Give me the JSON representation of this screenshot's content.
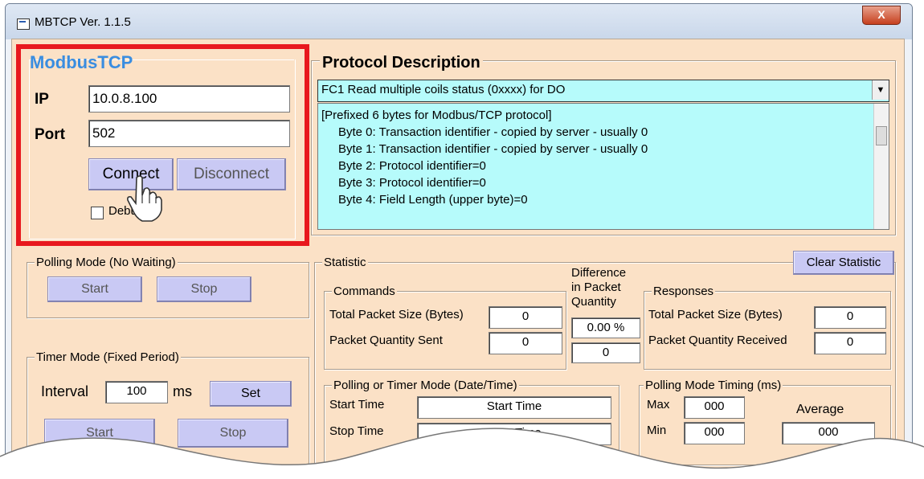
{
  "window": {
    "title": "MBTCP  Ver. 1.1.5",
    "close_label": "X"
  },
  "modbus": {
    "legend": "ModbusTCP",
    "ip_label": "IP",
    "ip_value": "10.0.8.100",
    "port_label": "Port",
    "port_value": "502",
    "connect": "Connect",
    "disconnect": "Disconnect",
    "debug_label": "Debug"
  },
  "protocol": {
    "legend": "Protocol Description",
    "selected": "FC1  Read multiple coils status (0xxxx)  for DO",
    "lines": [
      "[Prefixed 6 bytes for Modbus/TCP protocol]",
      "Byte 0: Transaction identifier - copied by server - usually 0",
      "Byte 1: Transaction identifier - copied by server - usually 0",
      "Byte 2: Protocol identifier=0",
      "Byte 3: Protocol identifier=0",
      "Byte 4: Field Length (upper byte)=0"
    ]
  },
  "polling": {
    "legend": "Polling Mode (No Waiting)",
    "start": "Start",
    "stop": "Stop"
  },
  "timer": {
    "legend": "Timer Mode (Fixed Period)",
    "interval_label": "Interval",
    "interval_value": "100",
    "unit": "ms",
    "set": "Set",
    "start": "Start",
    "stop": "Stop"
  },
  "statistic": {
    "legend": "Statistic",
    "clear": "Clear Statistic",
    "commands_legend": "Commands",
    "responses_legend": "Responses",
    "cmd_size_label": "Total Packet Size (Bytes)",
    "cmd_size": "0",
    "cmd_qty_label": "Packet Quantity Sent",
    "cmd_qty": "0",
    "diff_label": "Difference in Packet Quantity",
    "diff_pct": "0.00 %",
    "diff_qty": "0",
    "resp_size_label": "Total Packet Size (Bytes)",
    "resp_size": "0",
    "resp_qty_label": "Packet Quantity Received",
    "resp_qty": "0",
    "time_legend": "Polling  or Timer Mode  (Date/Time)",
    "start_time_label": "Start Time",
    "start_time": "Start Time",
    "stop_time_label": "Stop Time",
    "stop_time": "Stop Time",
    "timing_legend": "Polling Mode Timing (ms)",
    "max_label": "Max",
    "max": "000",
    "min_label": "Min",
    "min": "000",
    "avg_label": "Average",
    "avg": "000"
  }
}
